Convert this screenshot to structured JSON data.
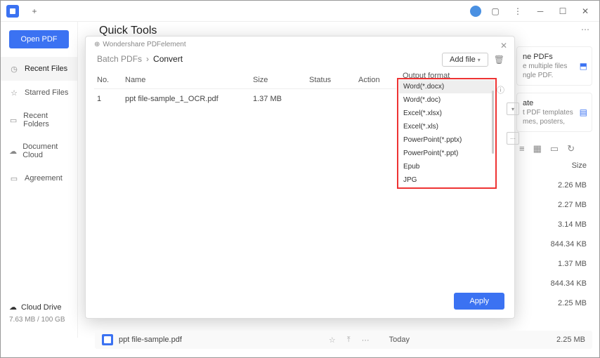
{
  "titlebar": {
    "plus": "+"
  },
  "sidebar": {
    "open_pdf": "Open PDF",
    "items": [
      {
        "label": "Recent Files"
      },
      {
        "label": "Starred Files"
      },
      {
        "label": "Recent Folders"
      },
      {
        "label": "Document Cloud"
      },
      {
        "label": "Agreement"
      }
    ],
    "cloud": {
      "title": "Cloud Drive",
      "usage": "7.63 MB / 100 GB"
    }
  },
  "main": {
    "title": "Quick Tools"
  },
  "dialog": {
    "tab": "Wondershare PDFelement",
    "crumb_root": "Batch PDFs",
    "crumb_sep": "›",
    "crumb_current": "Convert",
    "add_file": "Add file",
    "columns": {
      "no": "No.",
      "name": "Name",
      "size": "Size",
      "status": "Status",
      "action": "Action"
    },
    "rows": [
      {
        "no": "1",
        "name": "ppt file-sample_1_OCR.pdf",
        "size": "1.37 MB",
        "status": "",
        "action": ""
      }
    ],
    "output_label": "Output format",
    "output_selected": "Word(*.docx)",
    "dropdown": [
      "Word(*.docx)",
      "Word(*.doc)",
      "Excel(*.xlsx)",
      "Excel(*.xls)",
      "PowerPoint(*.pptx)",
      "PowerPoint(*.ppt)",
      "Epub",
      "JPG"
    ],
    "apply": "Apply"
  },
  "right": {
    "card1": {
      "title": "ne PDFs",
      "sub1": "e multiple files",
      "sub2": "ngle PDF."
    },
    "card2": {
      "title": "ate",
      "sub1": "t PDF templates",
      "sub2": "mes, posters,"
    },
    "size_head": "Size",
    "sizes": [
      "2.26 MB",
      "2.27 MB",
      "3.14 MB",
      "844.34 KB",
      "1.37 MB",
      "844.34 KB",
      "2.25 MB"
    ]
  },
  "recent": {
    "name": "ppt file-sample.pdf",
    "date": "Today",
    "size": "2.25 MB"
  }
}
